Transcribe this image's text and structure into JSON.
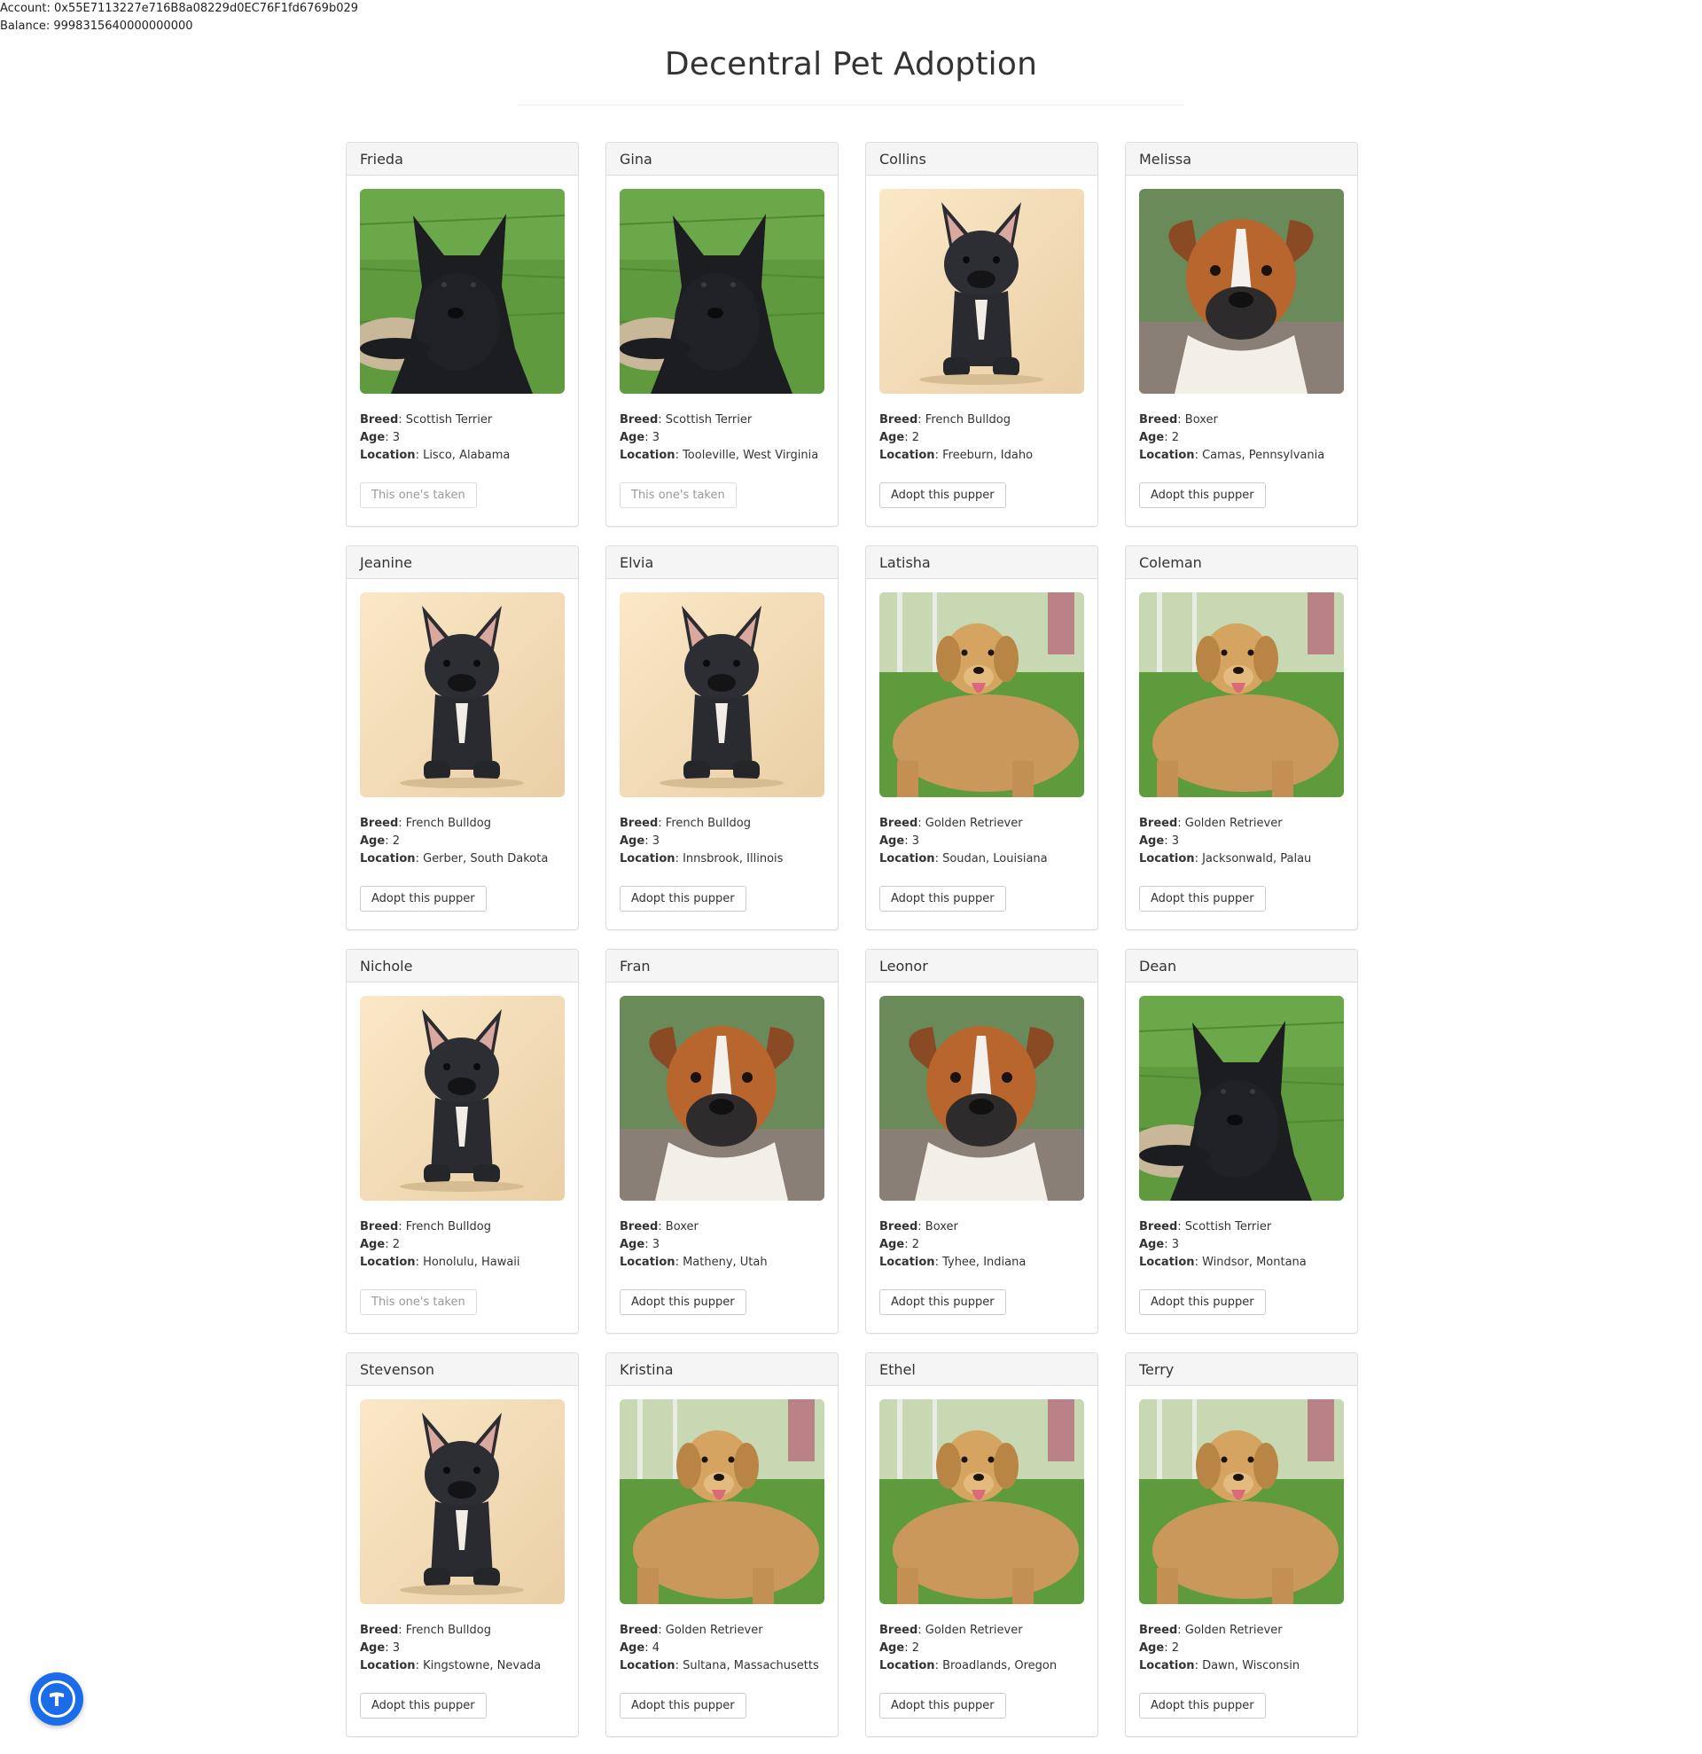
{
  "account": {
    "address_label": "Account: 0x55E7113227e716B8a08229d0EC76F1fd6769b029",
    "balance_label": "Balance: 9998315640000000000"
  },
  "page_title": "Decentral Pet Adoption",
  "labels": {
    "breed": "Breed",
    "age": "Age",
    "location": "Location"
  },
  "buttons": {
    "adopt": "Adopt this pupper",
    "taken": "This one's taken"
  },
  "pets": [
    {
      "name": "Frieda",
      "breed": "Scottish Terrier",
      "age": "3",
      "location": "Lisco, Alabama",
      "taken": true
    },
    {
      "name": "Gina",
      "breed": "Scottish Terrier",
      "age": "3",
      "location": "Tooleville, West Virginia",
      "taken": true
    },
    {
      "name": "Collins",
      "breed": "French Bulldog",
      "age": "2",
      "location": "Freeburn, Idaho",
      "taken": false
    },
    {
      "name": "Melissa",
      "breed": "Boxer",
      "age": "2",
      "location": "Camas, Pennsylvania",
      "taken": false
    },
    {
      "name": "Jeanine",
      "breed": "French Bulldog",
      "age": "2",
      "location": "Gerber, South Dakota",
      "taken": false
    },
    {
      "name": "Elvia",
      "breed": "French Bulldog",
      "age": "3",
      "location": "Innsbrook, Illinois",
      "taken": false
    },
    {
      "name": "Latisha",
      "breed": "Golden Retriever",
      "age": "3",
      "location": "Soudan, Louisiana",
      "taken": false
    },
    {
      "name": "Coleman",
      "breed": "Golden Retriever",
      "age": "3",
      "location": "Jacksonwald, Palau",
      "taken": false
    },
    {
      "name": "Nichole",
      "breed": "French Bulldog",
      "age": "2",
      "location": "Honolulu, Hawaii",
      "taken": true
    },
    {
      "name": "Fran",
      "breed": "Boxer",
      "age": "3",
      "location": "Matheny, Utah",
      "taken": false
    },
    {
      "name": "Leonor",
      "breed": "Boxer",
      "age": "2",
      "location": "Tyhee, Indiana",
      "taken": false
    },
    {
      "name": "Dean",
      "breed": "Scottish Terrier",
      "age": "3",
      "location": "Windsor, Montana",
      "taken": false
    },
    {
      "name": "Stevenson",
      "breed": "French Bulldog",
      "age": "3",
      "location": "Kingstowne, Nevada",
      "taken": false
    },
    {
      "name": "Kristina",
      "breed": "Golden Retriever",
      "age": "4",
      "location": "Sultana, Massachusetts",
      "taken": false
    },
    {
      "name": "Ethel",
      "breed": "Golden Retriever",
      "age": "2",
      "location": "Broadlands, Oregon",
      "taken": false
    },
    {
      "name": "Terry",
      "breed": "Golden Retriever",
      "age": "2",
      "location": "Dawn, Wisconsin",
      "taken": false
    }
  ],
  "floating_button": {
    "icon": "letter-t-logo-icon",
    "color": "#1c6ce8"
  }
}
